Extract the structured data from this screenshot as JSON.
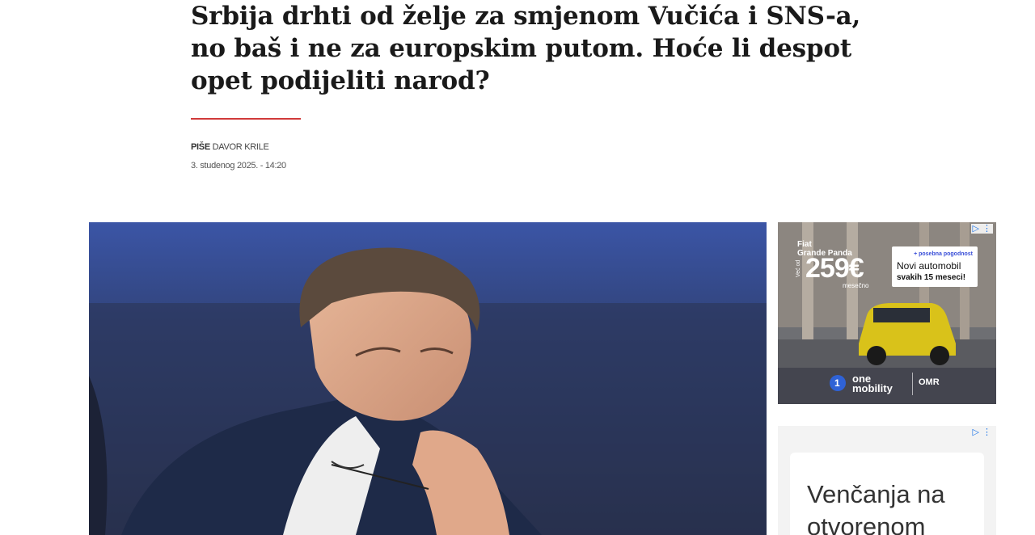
{
  "article": {
    "title": "Srbija drhti od želje za smjenom Vučića i SNS-a, no baš i ne za europskim putom. Hoće li despot opet podijeliti narod?",
    "byline_prefix": "PIŠE",
    "author": "DAVOR KRILE",
    "date": "3. studenog 2025. - 14:20"
  },
  "ad_top": {
    "model": "Fiat",
    "model2": "Grande Panda",
    "price_prefix": "Već od",
    "price": "259€",
    "per": "mesečno",
    "promo_small": "+ posebna pogodnost",
    "promo_line1": "Novi automobil",
    "promo_line2": "svakih 15 meseci!",
    "brand_num": "1",
    "brand_line1": "one",
    "brand_line2": "mobility",
    "partner": "OMR",
    "adchoices_icon": "adchoices-icon",
    "menu_icon": "vertical-dots-icon"
  },
  "ad_bottom": {
    "text": "Venčanja na otvorenom",
    "adchoices_icon": "adchoices-icon",
    "menu_icon": "vertical-dots-icon"
  },
  "colors": {
    "accent_rule": "#d13a3a",
    "hero_bg": "#2c3a63",
    "ad_car": "#d9c21a"
  }
}
